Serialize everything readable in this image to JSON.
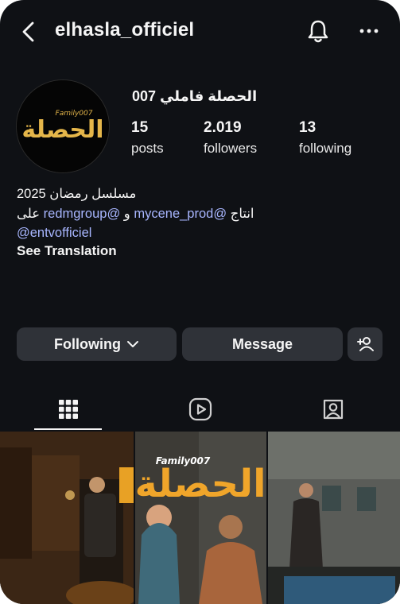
{
  "header": {
    "username": "elhasla_officiel",
    "icons": {
      "back": "chevron-left-icon",
      "notifications": "bell-icon",
      "more": "more-horizontal-icon"
    }
  },
  "profile": {
    "display_name": "الحصلة فاملي 007",
    "avatar_logo_text": "الحصلة",
    "avatar_logo_small": "Family007",
    "stats": {
      "posts": {
        "value": "15",
        "label": "posts"
      },
      "followers": {
        "value": "2.019",
        "label": "followers"
      },
      "following": {
        "value": "13",
        "label": "following"
      }
    }
  },
  "bio": {
    "line1": "مسلسل رمضان 2025",
    "line2_prefix": "انتاج ",
    "mention1": "@mycene_prod",
    "line2_mid": " و ",
    "mention2": "@redmgroup",
    "line2_suffix": " على",
    "mention3": "@entvofficiel",
    "see_translation": "See Translation"
  },
  "actions": {
    "following_label": "Following",
    "message_label": "Message",
    "icons": {
      "following_dropdown": "chevron-down-icon",
      "add_user": "add-user-icon"
    }
  },
  "tabs": {
    "icons": [
      "grid-icon",
      "reels-icon",
      "tagged-icon"
    ],
    "active": "grid-icon"
  },
  "posts_grid": {
    "poster_title": "الحصلة",
    "poster_subtitle": "Family007"
  },
  "colors": {
    "background": "#0f1115",
    "button": "#2f3238",
    "mention": "#a8b6ff",
    "poster_gold": "#f0a52a"
  }
}
